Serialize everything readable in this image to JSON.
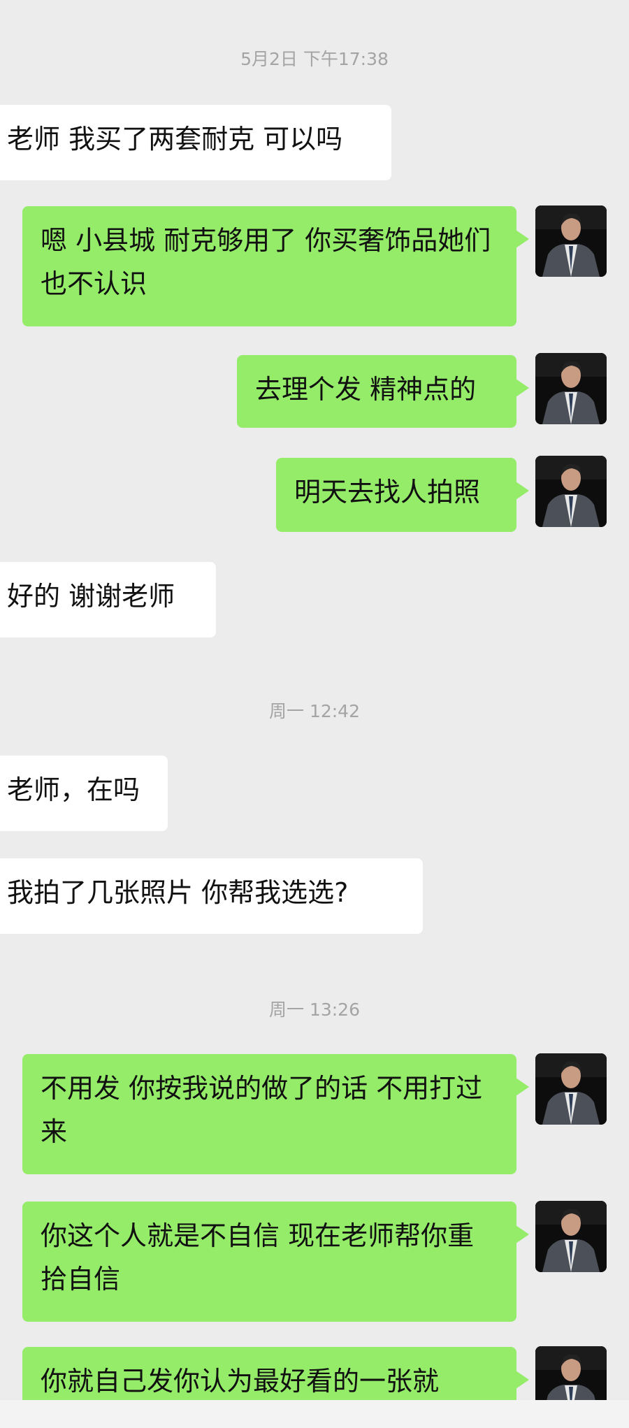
{
  "messages": [
    {
      "type": "time",
      "text": "5月2日 下午17:38"
    },
    {
      "type": "in",
      "text": "老师 我买了两套耐克 可以吗"
    },
    {
      "type": "out",
      "text": "嗯 小县城 耐克够用了 你买奢饰品她们也不认识"
    },
    {
      "type": "out",
      "text": "去理个发 精神点的"
    },
    {
      "type": "out",
      "text": "明天去找人拍照"
    },
    {
      "type": "in",
      "text": "好的 谢谢老师"
    },
    {
      "type": "time",
      "text": "周一 12:42"
    },
    {
      "type": "in",
      "text": "老师，在吗"
    },
    {
      "type": "in",
      "text": "我拍了几张照片 你帮我选选?"
    },
    {
      "type": "time",
      "text": "周一 13:26"
    },
    {
      "type": "out",
      "text": "不用发 你按我说的做了的话 不用打过来"
    },
    {
      "type": "out",
      "text": "你这个人就是不自信 现在老师帮你重拾自信"
    },
    {
      "type": "out",
      "text": "你就自己发你认为最好看的一张就"
    }
  ],
  "colors": {
    "background": "#ececec",
    "incoming_bubble": "#ffffff",
    "outgoing_bubble": "#95ec69",
    "timestamp_text": "#a4a4a4"
  },
  "icons": {
    "avatar": "user-avatar-photo"
  }
}
